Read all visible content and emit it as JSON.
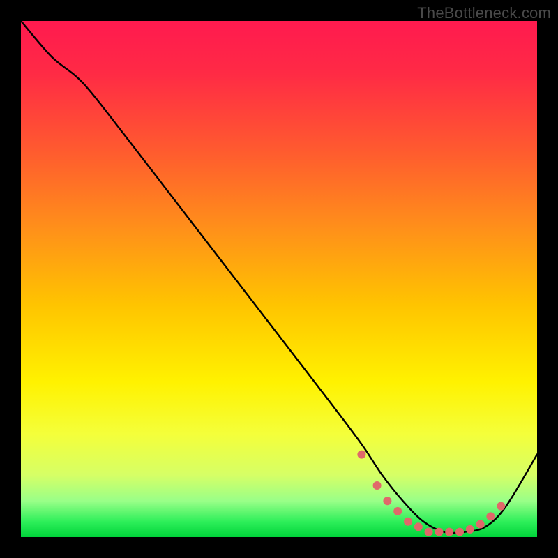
{
  "watermark": "TheBottleneck.com",
  "gradient": {
    "stops": [
      {
        "offset": 0.0,
        "color": "#ff1a4f"
      },
      {
        "offset": 0.1,
        "color": "#ff2a45"
      },
      {
        "offset": 0.25,
        "color": "#ff5a2f"
      },
      {
        "offset": 0.4,
        "color": "#ff8f1a"
      },
      {
        "offset": 0.55,
        "color": "#ffc400"
      },
      {
        "offset": 0.7,
        "color": "#fff200"
      },
      {
        "offset": 0.8,
        "color": "#f4ff3a"
      },
      {
        "offset": 0.88,
        "color": "#d6ff66"
      },
      {
        "offset": 0.93,
        "color": "#99ff88"
      },
      {
        "offset": 0.97,
        "color": "#2eef5a"
      },
      {
        "offset": 1.0,
        "color": "#00d43a"
      }
    ]
  },
  "chart_data": {
    "type": "line",
    "title": "",
    "xlabel": "",
    "ylabel": "",
    "xlim": [
      0,
      100
    ],
    "ylim": [
      0,
      100
    ],
    "series": [
      {
        "name": "curve",
        "x": [
          0,
          6,
          12,
          20,
          30,
          40,
          50,
          60,
          66,
          70,
          74,
          78,
          82,
          86,
          90,
          94,
          100
        ],
        "y": [
          100,
          93,
          88,
          78,
          65,
          52,
          39,
          26,
          18,
          12,
          7,
          3,
          1,
          1,
          2,
          6,
          16
        ]
      }
    ],
    "markers": {
      "name": "marker-points",
      "color": "#e0686a",
      "radius": 6,
      "x": [
        66,
        69,
        71,
        73,
        75,
        77,
        79,
        81,
        83,
        85,
        87,
        89,
        91,
        93
      ],
      "y": [
        16,
        10,
        7,
        5,
        3,
        2,
        1,
        1,
        1,
        1,
        1.5,
        2.5,
        4,
        6
      ]
    }
  }
}
